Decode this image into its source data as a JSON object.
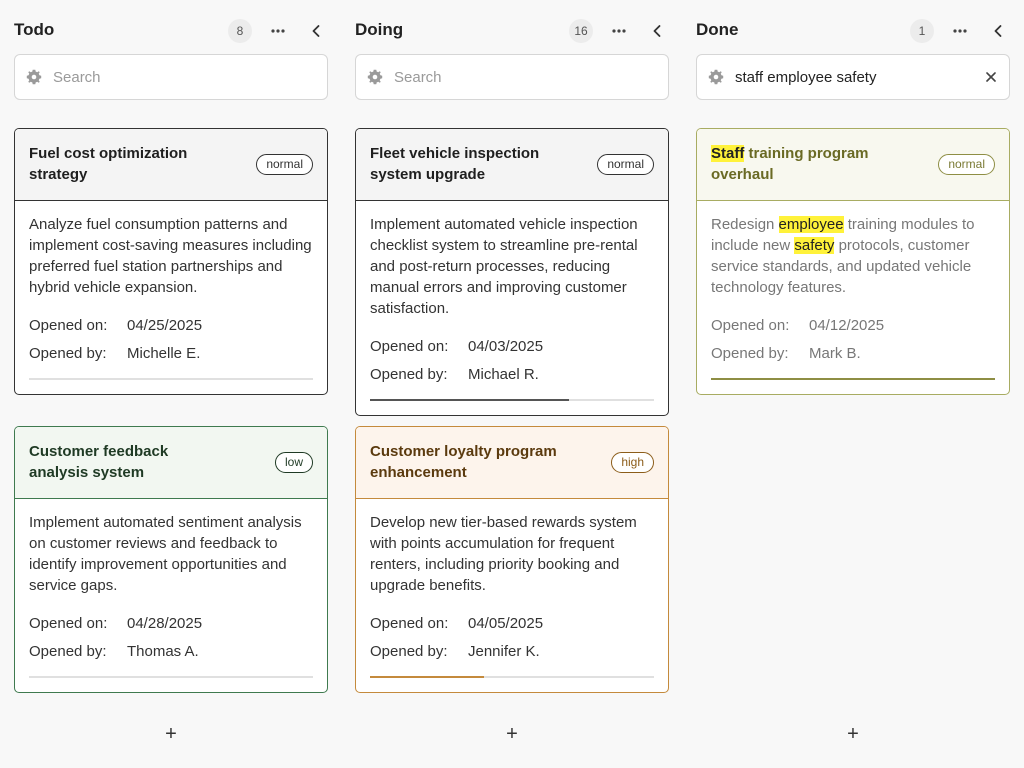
{
  "columns": [
    {
      "title": "Todo",
      "count": "8",
      "search": {
        "placeholder": "Search",
        "value": ""
      },
      "add_label": "+"
    },
    {
      "title": "Doing",
      "count": "16",
      "search": {
        "placeholder": "Search",
        "value": ""
      },
      "add_label": "+"
    },
    {
      "title": "Done",
      "count": "1",
      "search": {
        "placeholder": "Search",
        "value": "staff employee safety"
      },
      "add_label": "+"
    }
  ],
  "labels": {
    "opened_on": "Opened on:",
    "opened_by": "Opened by:"
  },
  "cards": {
    "fuel": {
      "title": "Fuel cost optimization strategy",
      "priority": "normal",
      "description": "Analyze fuel consumption patterns and implement cost-saving measures including preferred fuel station partnerships and hybrid vehicle expansion.",
      "opened_on": "04/25/2025",
      "opened_by": "Michelle E.",
      "progress": 0
    },
    "feedback": {
      "title": "Customer feedback analysis system",
      "priority": "low",
      "description": "Implement automated sentiment analysis on customer reviews and feedback to identify improvement opportunities and service gaps.",
      "opened_on": "04/28/2025",
      "opened_by": "Thomas A.",
      "progress": 0
    },
    "fleet": {
      "title": "Fleet vehicle inspection system upgrade",
      "priority": "normal",
      "description": "Implement automated vehicle inspection checklist system to streamline pre-rental and post-return processes, reducing manual errors and improving customer satisfaction.",
      "opened_on": "04/03/2025",
      "opened_by": "Michael R.",
      "progress": 0.7
    },
    "loyalty": {
      "title": "Customer loyalty program enhancement",
      "priority": "high",
      "description": "Develop new tier-based rewards system with points accumulation for frequent renters, including priority booking and upgrade benefits.",
      "opened_on": "04/05/2025",
      "opened_by": "Jennifer K.",
      "progress": 0.4
    },
    "staff": {
      "title_parts": [
        "Staff",
        " training program overhaul"
      ],
      "priority": "normal",
      "description_parts": [
        "Redesign ",
        "employee",
        " training modules to include new ",
        "safety",
        " protocols, customer service standards, and updated vehicle technology features."
      ],
      "opened_on": "04/12/2025",
      "opened_by": "Mark B.",
      "progress": 1
    }
  },
  "colors": {
    "low": "#3f7a4f",
    "high": "#c48a3c",
    "done": "#a8ac62",
    "highlight": "#fff23a"
  }
}
